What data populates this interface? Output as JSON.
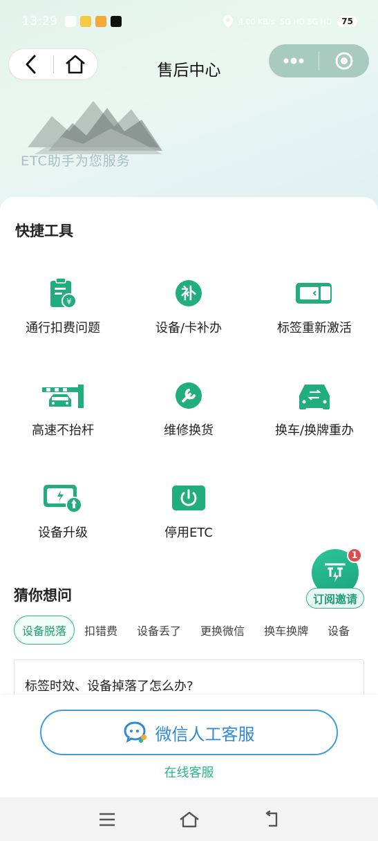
{
  "status_bar": {
    "time": "13:29",
    "network_speed": "4.00 KB/s",
    "signal": "5G HD 5G HD",
    "battery": "75"
  },
  "nav": {
    "title": "售后中心"
  },
  "banner": {
    "subtitle": "ETC助手为您服务"
  },
  "quick_tools": {
    "title": "快捷工具",
    "items": [
      {
        "label": "通行扣费问题",
        "icon": "receipt-yen-icon"
      },
      {
        "label": "设备/卡补办",
        "icon": "reissue-icon"
      },
      {
        "label": "标签重新激活",
        "icon": "obu-tag-icon"
      },
      {
        "label": "高速不抬杆",
        "icon": "toll-barrier-icon"
      },
      {
        "label": "维修换货",
        "icon": "wrench-icon"
      },
      {
        "label": "换车/换牌重办",
        "icon": "car-swap-icon"
      },
      {
        "label": "设备升级",
        "icon": "device-upgrade-icon"
      },
      {
        "label": "停用ETC",
        "icon": "power-icon"
      }
    ]
  },
  "guess": {
    "title": "猜你想问",
    "chips": [
      "设备脱落",
      "扣错费",
      "设备丢了",
      "更换微信",
      "换车换牌",
      "设备"
    ],
    "question": "标签时效、设备掉落了怎么办?"
  },
  "subscribe": {
    "label": "订阅邀请",
    "badge": "1"
  },
  "footer": {
    "wechat_service": "微信人工客服",
    "online_service": "在线客服"
  },
  "colors": {
    "accent": "#2bb58c",
    "icon_green": "#22ad7e",
    "wechat_blue": "#2f89d8"
  }
}
